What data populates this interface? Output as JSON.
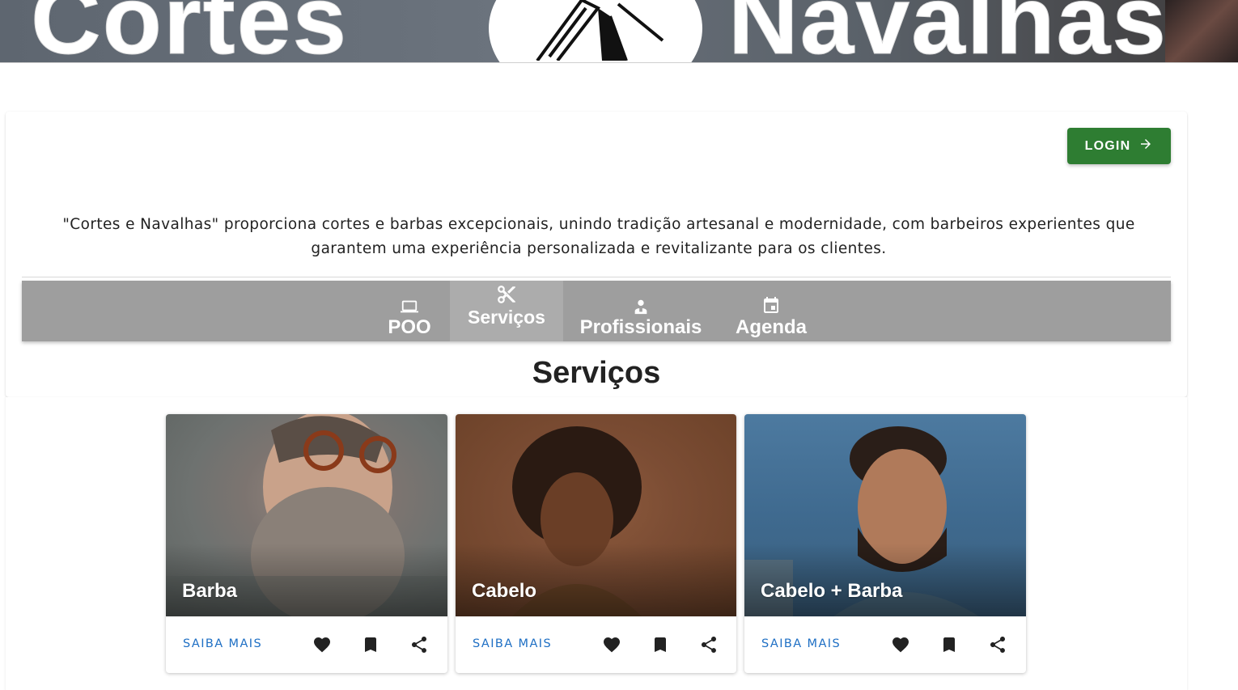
{
  "banner": {
    "word_left": "Cortes",
    "word_right": "Navalhas"
  },
  "header": {
    "login_label": "LOGIN"
  },
  "intro": {
    "description": "\"Cortes e Navalhas\" proporciona cortes e barbas excepcionais, unindo tradição artesanal e modernidade, com barbeiros experientes que garantem uma experiência personalizada e revitalizante para os clientes."
  },
  "tabs": [
    {
      "label": "POO",
      "icon": "laptop-icon"
    },
    {
      "label": "Serviços",
      "icon": "scissors-icon",
      "active": true
    },
    {
      "label": "Profissionais",
      "icon": "person-badge-icon"
    },
    {
      "label": "Agenda",
      "icon": "calendar-icon"
    }
  ],
  "section": {
    "title": "Serviços"
  },
  "services": [
    {
      "title": "Barba",
      "action_label": "SAIBA MAIS"
    },
    {
      "title": "Cabelo",
      "action_label": "SAIBA MAIS"
    },
    {
      "title": "Cabelo + Barba",
      "action_label": "SAIBA MAIS"
    }
  ],
  "colors": {
    "login_green": "#2e7d32",
    "tabbar_grey": "#9e9e9e",
    "link_blue": "#1e6fc4"
  }
}
